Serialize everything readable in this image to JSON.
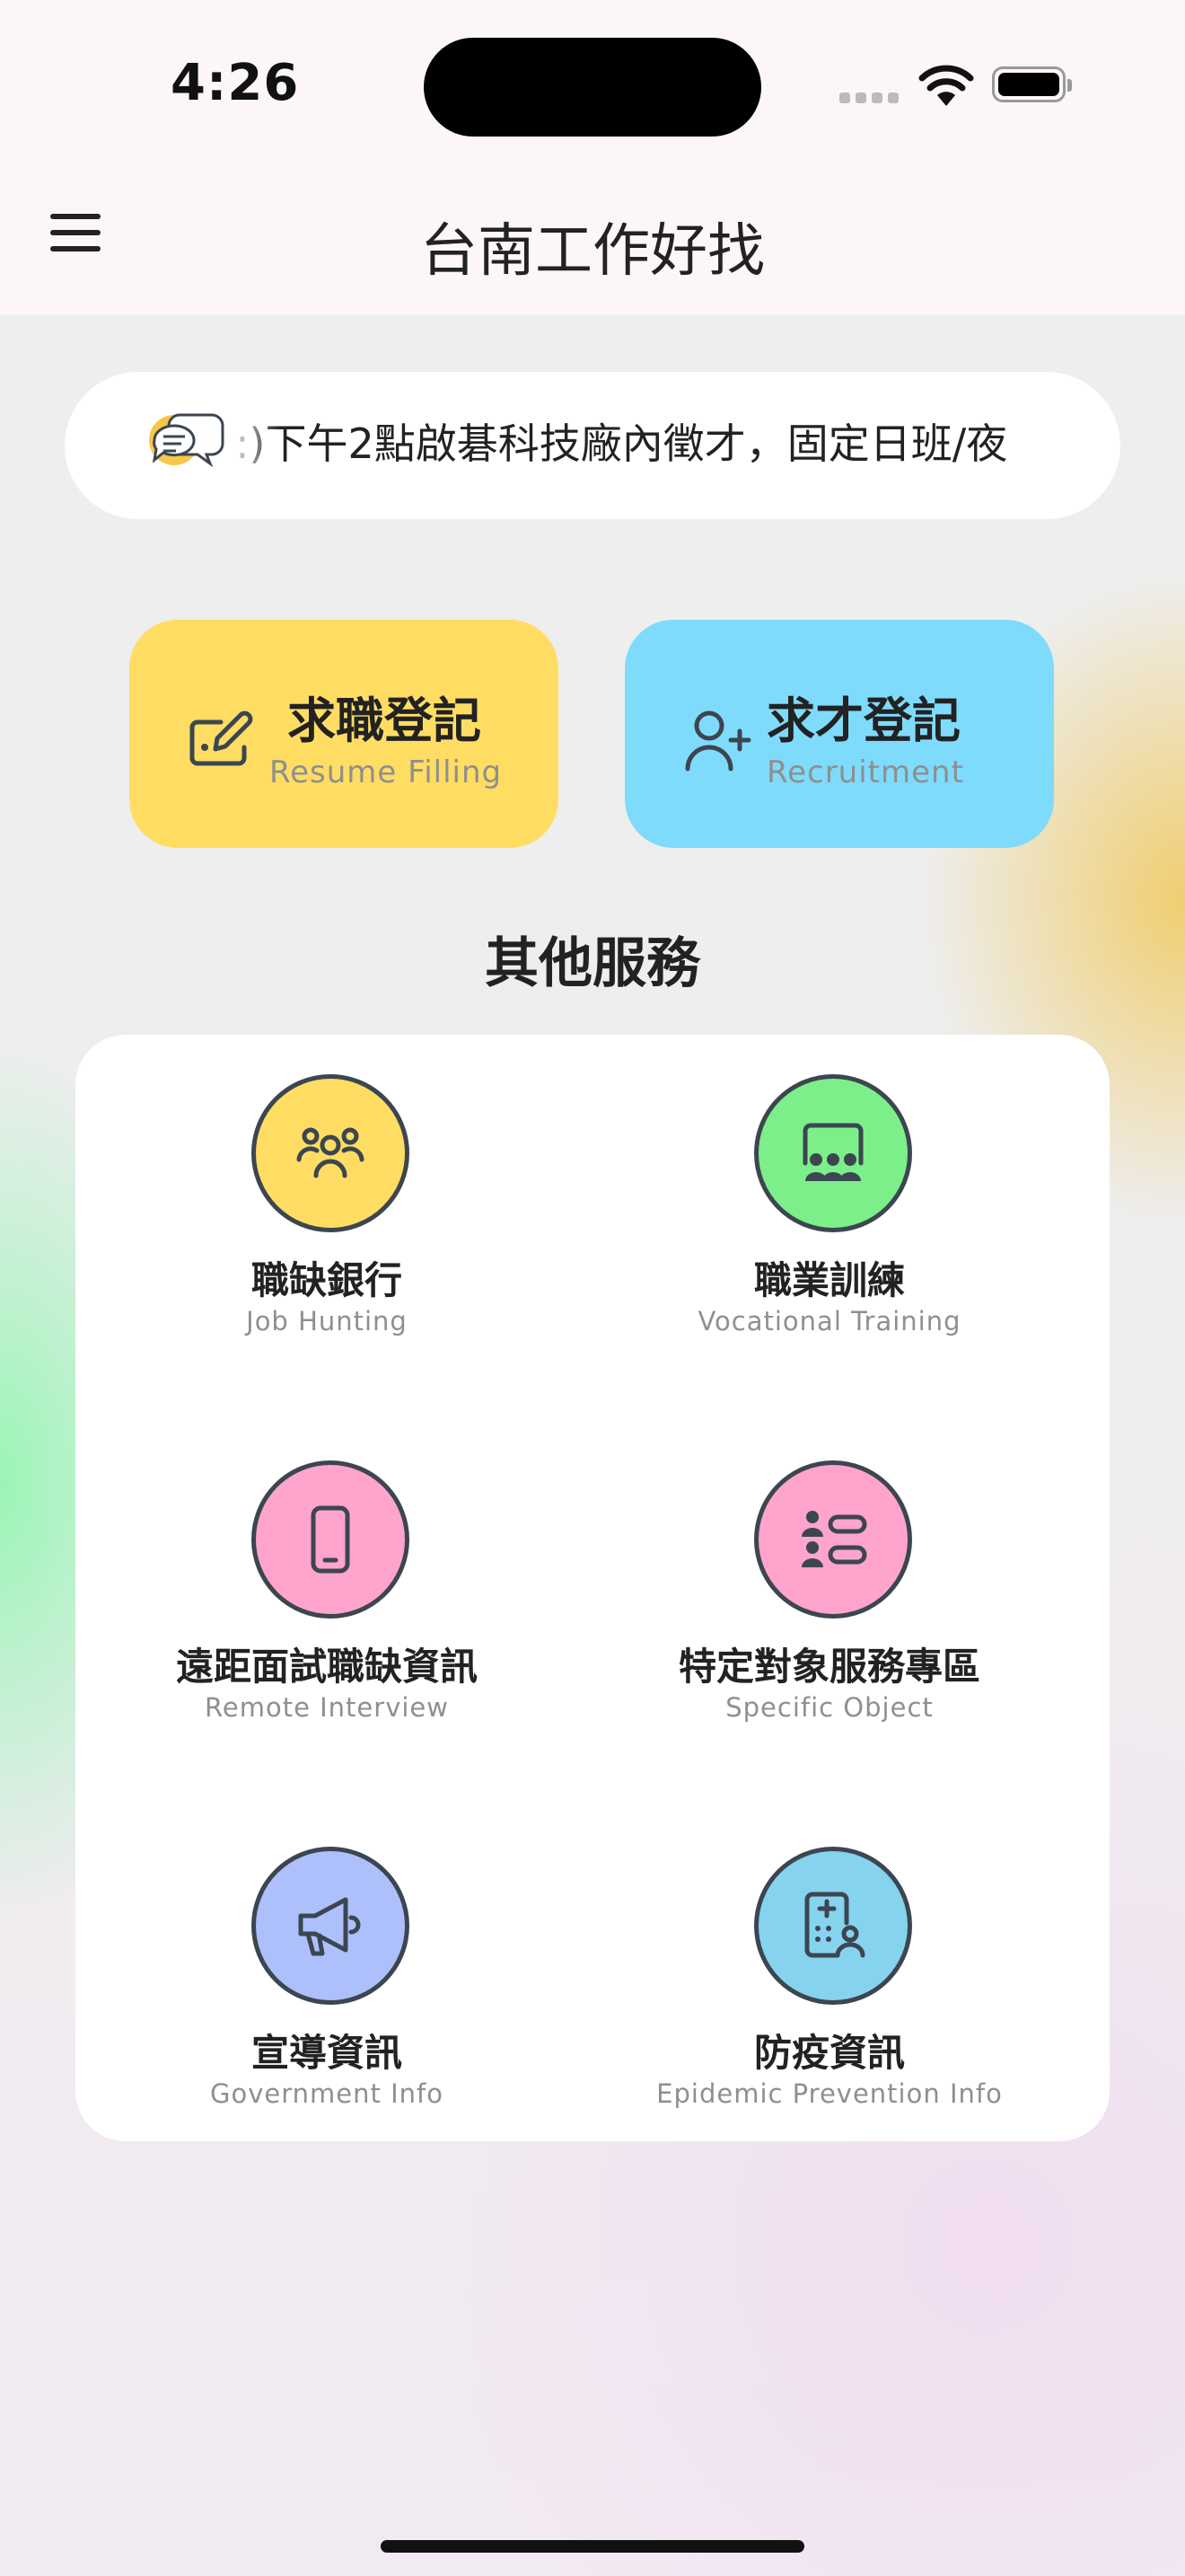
{
  "status_bar": {
    "time": "4:26"
  },
  "header": {
    "title": "台南工作好找",
    "menu_icon": "hamburger-menu-icon"
  },
  "announcement": {
    "text": ":)下午2點啟碁科技廠內徵才，固定日班/夜",
    "icon": "chat-bubbles-icon"
  },
  "primary_actions": [
    {
      "zh": "求職登記",
      "en": "Resume Filling",
      "icon": "edit-form-icon",
      "color": "#ffdd63"
    },
    {
      "zh": "求才登記",
      "en": "Recruitment",
      "icon": "add-user-icon",
      "color": "#7fdbfc"
    }
  ],
  "services": {
    "title": "其他服務",
    "items": [
      {
        "zh": "職缺銀行",
        "en": "Job Hunting",
        "icon": "users-icon",
        "color": "#ffdd63"
      },
      {
        "zh": "職業訓練",
        "en": "Vocational Training",
        "icon": "training-icon",
        "color": "#7def8a"
      },
      {
        "zh": "遠距面試職缺資訊",
        "en": "Remote Interview",
        "icon": "phone-icon",
        "color": "#ffa4cd"
      },
      {
        "zh": "特定對象服務專區",
        "en": "Specific Object",
        "icon": "people-list-icon",
        "color": "#ffa4cd"
      },
      {
        "zh": "宣導資訊",
        "en": "Government Info",
        "icon": "megaphone-icon",
        "color": "#aec0fb"
      },
      {
        "zh": "防疫資訊",
        "en": "Epidemic Prevention Info",
        "icon": "medical-report-icon",
        "color": "#86d3ee"
      }
    ]
  }
}
